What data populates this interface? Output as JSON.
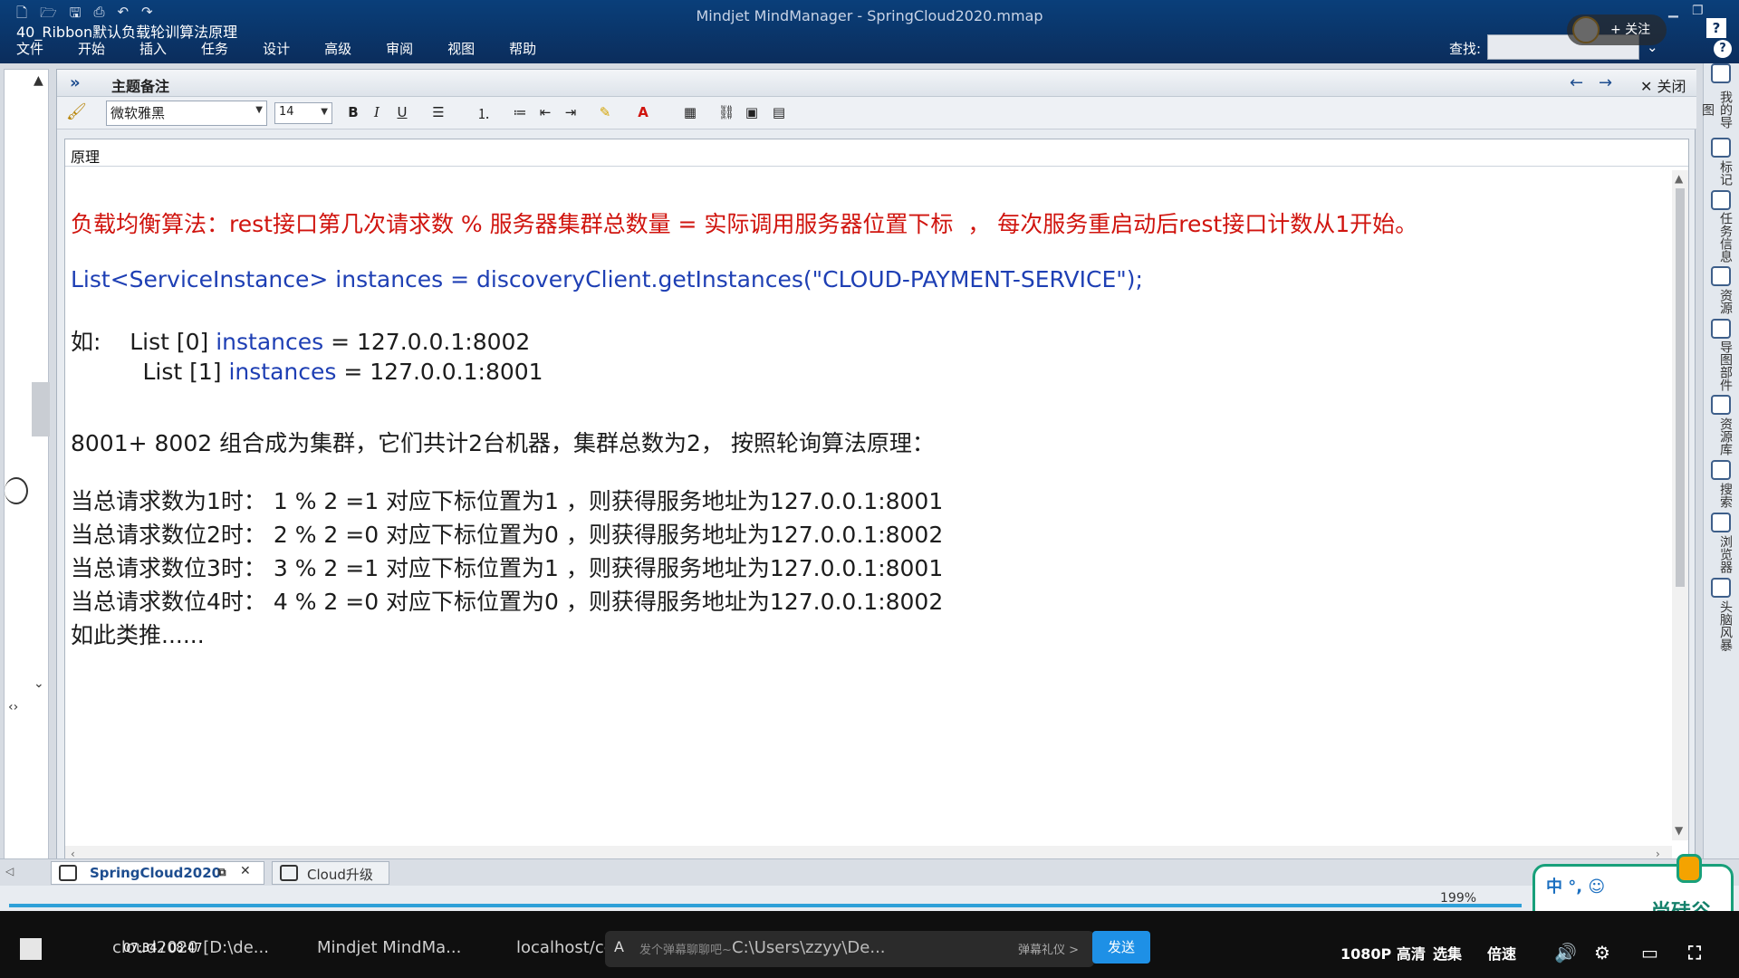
{
  "video_title": "40_Ribbon默认负载轮训算法原理",
  "app_title": "Mindjet MindManager - SpringCloud2020.mmap",
  "menu": [
    "文件",
    "开始",
    "插入",
    "任务",
    "设计",
    "高级",
    "审阅",
    "视图",
    "帮助"
  ],
  "find": {
    "label": "查找:",
    "value": ""
  },
  "follow_label": "+ 关注",
  "notes": {
    "title": "主题备注",
    "close_label": "关闭",
    "font": "微软雅黑",
    "size": "14",
    "topic": "原理",
    "lines": {
      "l1_red": "负载均衡算法：rest接口第几次请求数 % 服务器集群总数量 = 实际调用服务器位置下标  ， 每次服务重启动后rest接口计数从1开始。",
      "l2_blue": "List<ServiceInstance> instances = discoveryClient.getInstances(\"CLOUD-PAYMENT-SERVICE\");",
      "l3a": "如:    List [0] ",
      "l3b": "instances",
      "l3c": " = 127.0.0.1:8002",
      "l4a": "          List [1] ",
      "l4b": "instances",
      "l4c": " = 127.0.0.1:8001",
      "l5": "8001+ 8002 组合成为集群，它们共计2台机器，集群总数为2， 按照轮询算法原理：",
      "l6": "当总请求数为1时： 1 % 2 =1 对应下标位置为1 ，则获得服务地址为127.0.0.1:8001",
      "l7": "当总请求数位2时： 2 % 2 =0 对应下标位置为0 ，则获得服务地址为127.0.0.1:8002",
      "l8": "当总请求数位3时： 3 % 2 =1 对应下标位置为1 ，则获得服务地址为127.0.0.1:8001",
      "l9": "当总请求数位4时： 4 % 2 =0 对应下标位置为0 ，则获得服务地址为127.0.0.1:8002",
      "l10": "如此类推......"
    }
  },
  "right_sidebar": [
    "我的导图",
    "标记",
    "任务信息",
    "资源",
    "导图部件",
    "资源库",
    "搜索",
    "浏览器",
    "头脑风暴"
  ],
  "tabs": {
    "active": "SpringCloud2020",
    "inactive": "Cloud升级"
  },
  "status": {
    "zoom": "199%"
  },
  "ad": {
    "ime": "中 °, ☺",
    "brand": "尚硅谷"
  },
  "taskbar": {
    "item1": "cloud2020 [D:\\de...",
    "player_time": "07:34 / 08:47",
    "item2": "Mindjet MindMa...",
    "item3": "localhost/consum...",
    "item4": "C:\\Users\\zzyy\\De...",
    "danmu_hint": "发个弹幕聊聊吧~",
    "danmu_gift": "弹幕礼仪 >",
    "send": "发送",
    "quality": "1080P 高清",
    "episodes": "选集",
    "speed": "倍速"
  }
}
